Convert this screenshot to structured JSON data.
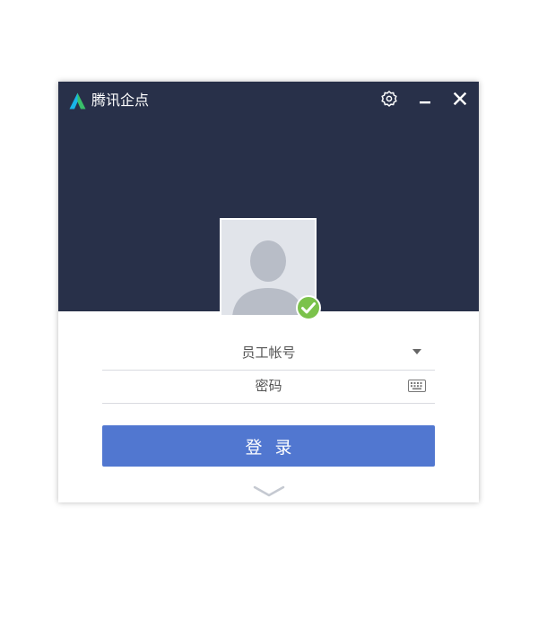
{
  "app": {
    "title": "腾讯企点",
    "logo_icon": "tencent-qidian-logo-icon"
  },
  "window_controls": {
    "settings_icon": "gear-icon",
    "minimize_icon": "minimize-icon",
    "close_icon": "close-icon"
  },
  "avatar": {
    "icon": "default-user-icon",
    "status_icon": "check-circle-icon",
    "status_color": "#7bc24b"
  },
  "login_form": {
    "account": {
      "placeholder": "员工帐号",
      "value": ""
    },
    "password": {
      "placeholder": "密码",
      "value": ""
    },
    "submit_label": "登录"
  },
  "colors": {
    "header_bg": "#283049",
    "accent": "#5177d0"
  }
}
